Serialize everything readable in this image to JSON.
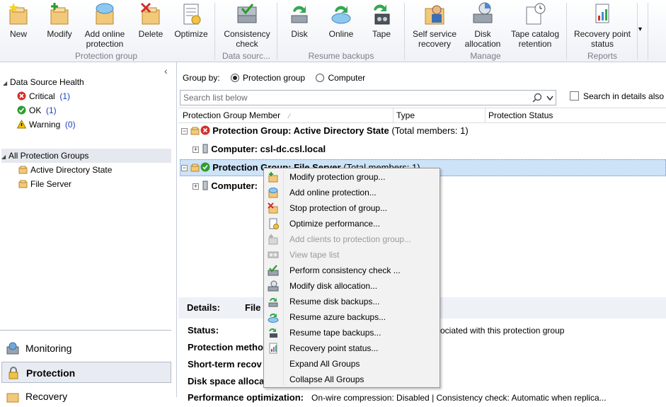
{
  "ribbon": {
    "buttons": [
      {
        "label": "New",
        "icon": "new-group-icon"
      },
      {
        "label": "Modify",
        "icon": "modify-group-icon"
      },
      {
        "label": "Add online protection",
        "icon": "online-protection-icon"
      },
      {
        "label": "Delete",
        "icon": "delete-icon"
      },
      {
        "label": "Optimize",
        "icon": "optimize-icon"
      },
      {
        "label": "Consistency check",
        "icon": "consistency-check-icon"
      },
      {
        "label": "Disk",
        "icon": "resume-disk-icon"
      },
      {
        "label": "Online",
        "icon": "resume-online-icon"
      },
      {
        "label": "Tape",
        "icon": "resume-tape-icon"
      },
      {
        "label": "Self service recovery",
        "icon": "self-service-icon"
      },
      {
        "label": "Disk allocation",
        "icon": "disk-allocation-icon"
      },
      {
        "label": "Tape catalog retention",
        "icon": "tape-catalog-icon"
      },
      {
        "label": "Recovery point status",
        "icon": "recovery-point-icon"
      }
    ],
    "groups": {
      "protection_group": "Protection group",
      "data_source": "Data sourc...",
      "resume_backups": "Resume backups",
      "manage": "Manage",
      "reports": "Reports"
    },
    "overflow": "▾"
  },
  "left_nav": {
    "health_title": "Data Source Health",
    "health": [
      {
        "label": "Critical",
        "count": "(1)",
        "icon": "critical-icon"
      },
      {
        "label": "OK",
        "count": "(1)",
        "icon": "ok-icon"
      },
      {
        "label": "Warning",
        "count": "(0)",
        "icon": "warning-icon"
      }
    ],
    "groups_title": "All Protection Groups",
    "groups": [
      "Active Directory State",
      "File Server"
    ],
    "bottom_nav": [
      "Monitoring",
      "Protection",
      "Recovery"
    ]
  },
  "main": {
    "group_by_label": "Group by:",
    "group_by_options": [
      "Protection group",
      "Computer"
    ],
    "group_by_selected": "Protection group",
    "search_placeholder": "Search list below",
    "search_details_label": "Search in details also",
    "columns": [
      "Protection Group Member",
      "Type",
      "Protection Status"
    ],
    "rows": [
      {
        "kind": "group",
        "name": "Protection Group: Active Directory State",
        "suffix": "(Total members: 1)",
        "status": "critical"
      },
      {
        "kind": "computer",
        "name": "Computer: csl-dc.csl.local"
      },
      {
        "kind": "group",
        "name": "Protection Group: File Server",
        "suffix": "(Total members: 1)",
        "status": "ok",
        "selected": true
      },
      {
        "kind": "computer",
        "name": "Computer:"
      }
    ]
  },
  "details": {
    "title": "Details:",
    "value": "File",
    "labels": [
      "Status:",
      "Protection metho",
      "Short-term recov",
      "Disk space alloca",
      "Performance optimization:"
    ],
    "status_text": "ociated with this protection group",
    "perf_text": "On-wire compression: Disabled | Consistency check: Automatic when replica..."
  },
  "context_menu": {
    "items": [
      {
        "label": "Modify protection group...",
        "icon": "modify-group-icon",
        "enabled": true
      },
      {
        "label": "Add online protection...",
        "icon": "online-protection-icon",
        "enabled": true
      },
      {
        "label": "Stop protection of group...",
        "icon": "stop-protection-icon",
        "enabled": true
      },
      {
        "label": "Optimize performance...",
        "icon": "optimize-icon",
        "enabled": true
      },
      {
        "label": "Add clients to protection group...",
        "icon": "add-clients-icon",
        "enabled": false
      },
      {
        "label": "View tape list",
        "icon": "tape-list-icon",
        "enabled": false
      },
      {
        "label": "Perform consistency check ...",
        "icon": "consistency-check-icon",
        "enabled": true
      },
      {
        "label": "Modify disk allocation...",
        "icon": "disk-allocation-icon",
        "enabled": true
      },
      {
        "label": "Resume disk backups...",
        "icon": "resume-disk-icon",
        "enabled": true
      },
      {
        "label": "Resume azure backups...",
        "icon": "resume-online-icon",
        "enabled": true
      },
      {
        "label": "Resume tape backups...",
        "icon": "resume-tape-icon",
        "enabled": true
      },
      {
        "label": "Recovery point status...",
        "icon": "recovery-point-icon",
        "enabled": true
      },
      {
        "label": "Expand All Groups",
        "icon": "",
        "enabled": true
      },
      {
        "label": "Collapse All Groups",
        "icon": "",
        "enabled": true
      }
    ]
  },
  "colors": {
    "accent": "#3b7ddd",
    "selection": "#cde3f7",
    "critical": "#d4302b",
    "ok": "#2f9e2f",
    "warning": "#e8b400"
  }
}
